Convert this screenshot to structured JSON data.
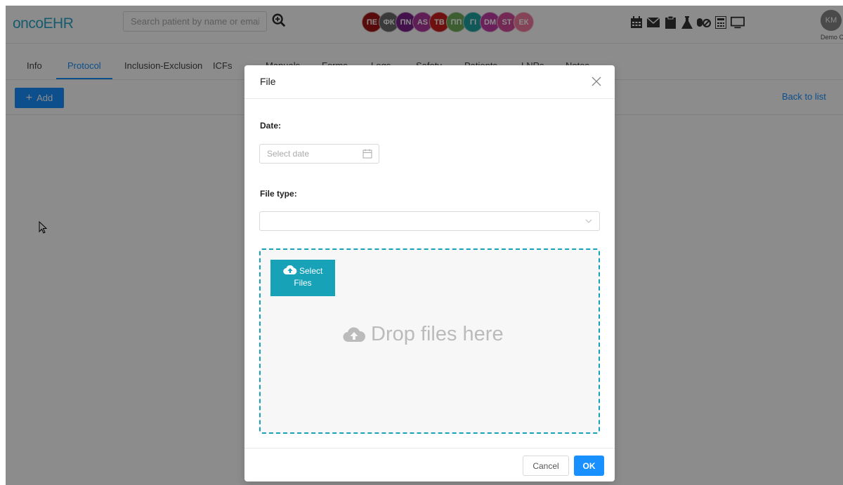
{
  "app": {
    "logo": "oncoEHR",
    "search_placeholder": "Search patient by name or email"
  },
  "header": {
    "patient_avatars": [
      {
        "initials": "ПЕ",
        "color": "#a01515"
      },
      {
        "initials": "ФК",
        "color": "#6b6b6b"
      },
      {
        "initials": "ПN",
        "color": "#7a1f8a"
      },
      {
        "initials": "AS",
        "color": "#b0389e"
      },
      {
        "initials": "ТВ",
        "color": "#c81e1e"
      },
      {
        "initials": "ПП",
        "color": "#6fab5a"
      },
      {
        "initials": "ГІ",
        "color": "#1fa3a3"
      },
      {
        "initials": "DM",
        "color": "#c23ca6"
      },
      {
        "initials": "ST",
        "color": "#d44a9a"
      },
      {
        "initials": "ЕК",
        "color": "#f27aa0"
      }
    ],
    "icons": [
      "calendar-icon",
      "mail-icon",
      "clipboard-icon",
      "flask-icon",
      "pills-icon",
      "calculator-icon",
      "monitor-icon"
    ],
    "user_initials": "KM",
    "user_clinic": "Demo Clinic"
  },
  "tabs": [
    {
      "label": "Info"
    },
    {
      "label": "Protocol"
    },
    {
      "label": "Inclusion-Exclusion"
    },
    {
      "label": "ICFs"
    },
    {
      "label": "Manuals"
    },
    {
      "label": "Forms"
    },
    {
      "label": "Logs"
    },
    {
      "label": "Safety"
    },
    {
      "label": "Patients"
    },
    {
      "label": "LNRs"
    },
    {
      "label": "Notes"
    }
  ],
  "active_tab": "Protocol",
  "toolbar": {
    "add_label": "Add",
    "back_label": "Back to list"
  },
  "modal": {
    "title": "File",
    "date_label": "Date",
    "date_placeholder": "Select date",
    "file_type_label": "File type",
    "file_type_value": "",
    "select_files_line1": "Select",
    "select_files_line2": "Files",
    "drop_text": "Drop files here",
    "cancel_label": "Cancel",
    "ok_label": "OK"
  },
  "colors": {
    "primary": "#1890ff",
    "dropzone_accent": "#17a2b8",
    "logo": "#2aa7c9"
  }
}
